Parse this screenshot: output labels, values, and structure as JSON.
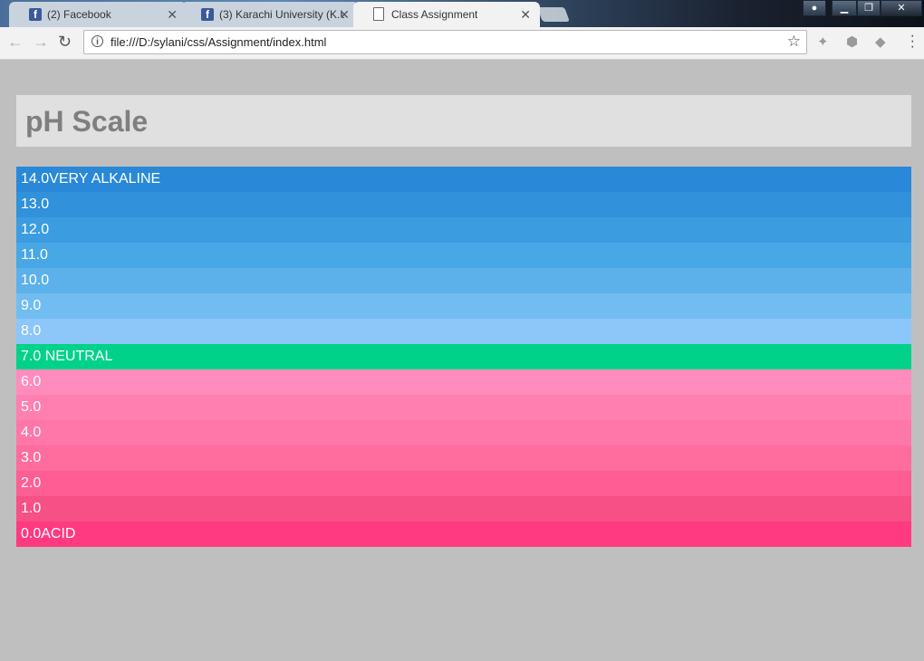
{
  "browser": {
    "tabs": [
      {
        "title": "(2) Facebook",
        "icon": "facebook-icon",
        "active": false
      },
      {
        "title": "(3) Karachi University (K.U",
        "icon": "facebook-icon",
        "active": false
      },
      {
        "title": "Class Assignment",
        "icon": "document-icon",
        "active": true
      }
    ],
    "address": "file:///D:/sylani/css/Assignment/index.html"
  },
  "page": {
    "title": "pH Scale",
    "rows": [
      {
        "label": "14.0VERY ALKALINE",
        "color": "#2989d8"
      },
      {
        "label": "13.0",
        "color": "#3191db"
      },
      {
        "label": "12.0",
        "color": "#3b9ce0"
      },
      {
        "label": "11.0",
        "color": "#48a7e5"
      },
      {
        "label": "10.0",
        "color": "#5cb1ea"
      },
      {
        "label": "9.0",
        "color": "#71bdf1"
      },
      {
        "label": "8.0",
        "color": "#8dc6f9"
      },
      {
        "label": "7.0 NEUTRAL",
        "color": "#00d28a"
      },
      {
        "label": "6.0",
        "color": "#ff8cbc"
      },
      {
        "label": "5.0",
        "color": "#ff80b0"
      },
      {
        "label": "4.0",
        "color": "#ff76a8"
      },
      {
        "label": "3.0",
        "color": "#ff6c9e"
      },
      {
        "label": "2.0",
        "color": "#fe5e93"
      },
      {
        "label": "1.0",
        "color": "#f65086"
      },
      {
        "label": "0.0ACID",
        "color": "#ff3a80"
      }
    ]
  }
}
